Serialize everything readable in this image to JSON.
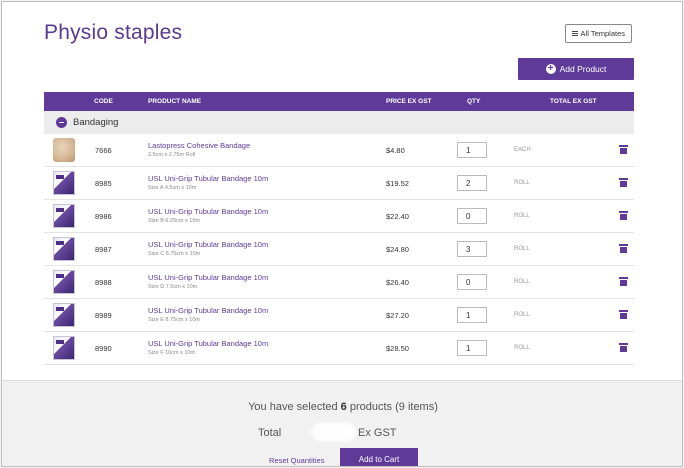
{
  "page_title": "Physio staples",
  "templates_button": "All Templates",
  "add_product_button": "Add Product",
  "columns": {
    "code": "CODE",
    "name": "PRODUCT NAME",
    "price": "PRICE EX GST",
    "qty": "QTY",
    "total": "TOTAL EX GST"
  },
  "group": {
    "name": "Bandaging"
  },
  "rows": [
    {
      "code": "7666",
      "name": "Lastopress Cohesive Bandage",
      "sub": "2.5cm x 2.75m Roll",
      "price": "$4.80",
      "qty": "1",
      "unit": "EACH",
      "thumb": "roll"
    },
    {
      "code": "8985",
      "name": "USL Uni-Grip Tubular Bandage 10m",
      "sub": "Size A 4.5cm x 10m",
      "price": "$19.52",
      "qty": "2",
      "unit": "ROLL",
      "thumb": "box"
    },
    {
      "code": "8986",
      "name": "USL Uni-Grip Tubular Bandage 10m",
      "sub": "Size B 6.25cm x 10m",
      "price": "$22.40",
      "qty": "0",
      "unit": "ROLL",
      "thumb": "box"
    },
    {
      "code": "8987",
      "name": "USL Uni-Grip Tubular Bandage 10m",
      "sub": "Size C 6.75cm x 10m",
      "price": "$24.80",
      "qty": "3",
      "unit": "ROLL",
      "thumb": "box"
    },
    {
      "code": "8988",
      "name": "USL Uni-Grip Tubular Bandage 10m",
      "sub": "Size D 7.5cm x 10m",
      "price": "$26.40",
      "qty": "0",
      "unit": "ROLL",
      "thumb": "box"
    },
    {
      "code": "8989",
      "name": "USL Uni-Grip Tubular Bandage 10m",
      "sub": "Size E 8.75cm x 10m",
      "price": "$27.20",
      "qty": "1",
      "unit": "ROLL",
      "thumb": "box"
    },
    {
      "code": "8990",
      "name": "USL Uni-Grip Tubular Bandage 10m",
      "sub": "Size F 10cm x 10m",
      "price": "$28.50",
      "qty": "1",
      "unit": "ROLL",
      "thumb": "box"
    }
  ],
  "footer": {
    "selected_prefix": "You have selected",
    "selected_count": "6",
    "selected_suffix": "products (9 items)",
    "total_label": "Total",
    "total_suffix": "Ex GST",
    "reset": "Reset Quantities",
    "cart": "Add to Cart"
  },
  "colors": {
    "accent": "#5f3a99"
  }
}
